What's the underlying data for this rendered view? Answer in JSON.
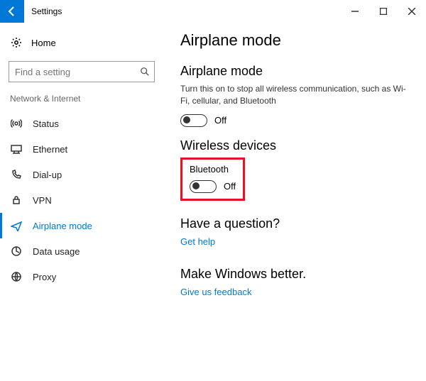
{
  "titlebar": {
    "app_name": "Settings"
  },
  "sidebar": {
    "home_label": "Home",
    "search_placeholder": "Find a setting",
    "category": "Network & Internet",
    "items": [
      {
        "label": "Status"
      },
      {
        "label": "Ethernet"
      },
      {
        "label": "Dial-up"
      },
      {
        "label": "VPN"
      },
      {
        "label": "Airplane mode"
      },
      {
        "label": "Data usage"
      },
      {
        "label": "Proxy"
      }
    ]
  },
  "content": {
    "title": "Airplane mode",
    "airplane": {
      "heading": "Airplane mode",
      "desc": "Turn this on to stop all wireless communication, such as Wi-Fi, cellular, and Bluetooth",
      "state_label": "Off"
    },
    "wireless": {
      "heading": "Wireless devices",
      "bluetooth_label": "Bluetooth",
      "bluetooth_state": "Off"
    },
    "question": {
      "heading": "Have a question?",
      "link": "Get help"
    },
    "feedback": {
      "heading": "Make Windows better.",
      "link": "Give us feedback"
    }
  }
}
